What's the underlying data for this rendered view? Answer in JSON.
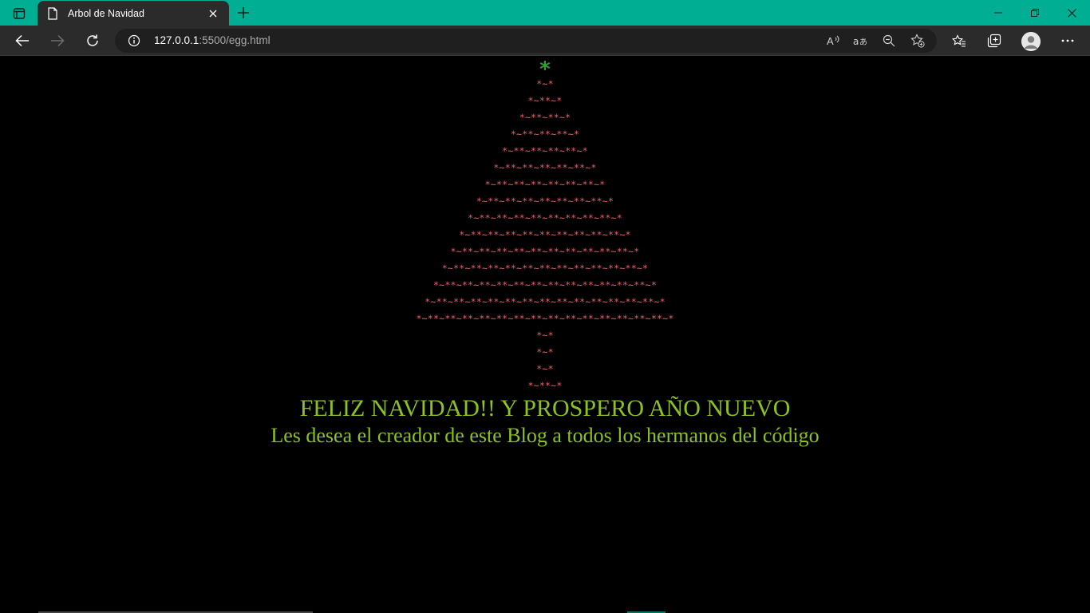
{
  "browser": {
    "tab_title": "Arbol de Navidad",
    "url_host": "127.0.0.1",
    "url_rest": ":5500/egg.html",
    "icons": {
      "tab_actions": "tab-actions-icon",
      "favicon": "page-icon",
      "close": "close-icon",
      "new_tab": "plus-icon",
      "back": "back-arrow-icon",
      "forward": "forward-arrow-icon",
      "refresh": "refresh-icon",
      "info": "info-icon",
      "read_aloud": "read-aloud-icon",
      "translate": "translate-icon",
      "zoom_out": "zoom-out-icon",
      "add_favorite": "add-favorite-icon",
      "favorites": "favorites-icon",
      "collections": "collections-icon",
      "profile": "profile-icon",
      "more": "more-icon"
    }
  },
  "page": {
    "star": "*",
    "tree_rows": [
      "*~*",
      "*~**~*",
      "*~**~**~*",
      "*~**~**~**~*",
      "*~**~**~**~**~*",
      "*~**~**~**~**~**~*",
      "*~**~**~**~**~**~**~*",
      "*~**~**~**~**~**~**~**~*",
      "*~**~**~**~**~**~**~**~**~*",
      "*~**~**~**~**~**~**~**~**~**~*",
      "*~**~**~**~**~**~**~**~**~**~**~*",
      "*~**~**~**~**~**~**~**~**~**~**~**~*",
      "*~**~**~**~**~**~**~**~**~**~**~**~**~*",
      "*~**~**~**~**~**~**~**~**~**~**~**~**~**~*",
      "*~**~**~**~**~**~**~**~**~**~**~**~**~**~**~*",
      "*~*",
      "*~*",
      "*~*",
      "*~**~*"
    ],
    "greeting": "FELIZ NAVIDAD!! Y PROSPERO AÑO NUEVO",
    "subtitle": "Les desea el creador de este Blog a todos los hermanos del código"
  },
  "colors": {
    "titlebar": "#00ae93",
    "tree": "#e8606a",
    "star": "#2f9e2f",
    "text": "#8bc21f"
  }
}
